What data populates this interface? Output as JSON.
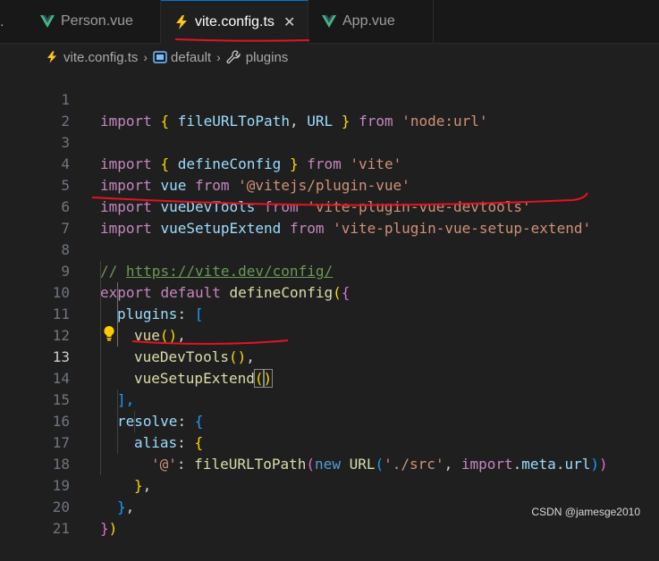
{
  "tabs": [
    {
      "label": "Person.vue",
      "icon": "vue-icon"
    },
    {
      "label": "vite.config.ts",
      "icon": "lightning-icon",
      "active": true,
      "close": "✕"
    },
    {
      "label": "App.vue",
      "icon": "vue-icon"
    }
  ],
  "breadcrumb": {
    "file": "vite.config.ts",
    "symbol1": "default",
    "symbol2": "plugins"
  },
  "editor": {
    "current_line": "13",
    "line_numbers": [
      "1",
      "2",
      "3",
      "4",
      "5",
      "6",
      "7",
      "8",
      "9",
      "10",
      "11",
      "12",
      "13",
      "14",
      "15",
      "16",
      "17",
      "18",
      "19",
      "20",
      "21"
    ],
    "lines": {
      "l1": {
        "a": "import",
        "b": "{",
        "c": "fileURLToPath",
        "d": ",",
        "e": "URL",
        "f": "}",
        "g": "from",
        "h": "'node:url'"
      },
      "l3": {
        "a": "import",
        "b": "{",
        "c": "defineConfig",
        "d": "}",
        "e": "from",
        "f": "'vite'"
      },
      "l4": {
        "a": "import",
        "b": "vue",
        "c": "from",
        "d": "'@vitejs/plugin-vue'"
      },
      "l5": {
        "a": "import",
        "b": "vueDevTools",
        "c": "from",
        "d": "'vite-plugin-vue-devtools'"
      },
      "l6": {
        "a": "import",
        "b": "vueSetupExtend",
        "c": "from",
        "d": "'vite-plugin-vue-setup-extend'"
      },
      "l8": {
        "a": "// ",
        "b": "https://vite.dev/config/"
      },
      "l9": {
        "a": "export",
        "b": "default",
        "c": "defineConfig",
        "d": "(",
        "e": "{"
      },
      "l10": {
        "a": "plugins",
        "b": ":",
        "c": "["
      },
      "l11": {
        "a": "vue",
        "b": "()",
        "c": ","
      },
      "l12": {
        "a": "vueDevTools",
        "b": "()",
        "c": ","
      },
      "l13": {
        "a": "vueSetupExtend",
        "b": "(",
        "c": ")"
      },
      "l14": {
        "a": "],"
      },
      "l15": {
        "a": "resolve",
        "b": ":",
        "c": "{"
      },
      "l16": {
        "a": "alias",
        "b": ":",
        "c": "{"
      },
      "l17": {
        "a": "'@'",
        "b": ": ",
        "c": "fileURLToPath",
        "d": "(",
        "e": "new",
        "f": "URL",
        "g": "(",
        "h": "'./src'",
        "i": ", ",
        "j": "import",
        "k": ".",
        "l": "meta",
        "m": ".",
        "n": "url",
        "o": ")",
        "p": ")"
      },
      "l18": {
        "a": "}",
        "b": ","
      },
      "l19": {
        "a": "}",
        "b": ","
      },
      "l20": {
        "a": "}",
        "b": ")"
      }
    }
  },
  "watermark": "CSDN @jamesge2010",
  "colors": {
    "background": "#1f1f1f",
    "keyword": "#569cd6",
    "control_keyword": "#c586c0",
    "function": "#dcdcaa",
    "variable": "#9cdcfe",
    "string": "#ce9178",
    "comment": "#6a9955",
    "annotation_red": "#e81123"
  }
}
